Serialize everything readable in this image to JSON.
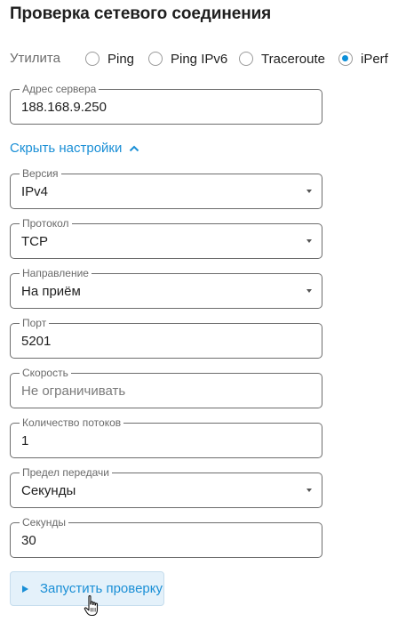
{
  "page": {
    "title": "Проверка сетевого соединения"
  },
  "utility": {
    "label": "Утилита",
    "options": [
      {
        "label": "Ping",
        "checked": false
      },
      {
        "label": "Ping IPv6",
        "checked": false
      },
      {
        "label": "Traceroute",
        "checked": false
      },
      {
        "label": "iPerf",
        "checked": true
      }
    ]
  },
  "server": {
    "label": "Адрес сервера",
    "value": "188.168.9.250"
  },
  "settings_toggle": {
    "label": "Скрыть настройки",
    "icon": "chevron-up-icon"
  },
  "fields": {
    "version": {
      "label": "Версия",
      "value": "IPv4"
    },
    "protocol": {
      "label": "Протокол",
      "value": "TCP"
    },
    "direction": {
      "label": "Направление",
      "value": "На приём"
    },
    "port": {
      "label": "Порт",
      "value": "5201"
    },
    "speed": {
      "label": "Скорость",
      "placeholder": "Не ограничивать"
    },
    "streams": {
      "label": "Количество потоков",
      "value": "1"
    },
    "limit": {
      "label": "Предел передачи",
      "value": "Секунды"
    },
    "seconds": {
      "label": "Секунды",
      "value": "30"
    }
  },
  "run_button": {
    "label": "Запустить проверку",
    "icon": "play-icon"
  },
  "colors": {
    "accent": "#1a8fd6",
    "button_bg": "#e4f1fa"
  }
}
